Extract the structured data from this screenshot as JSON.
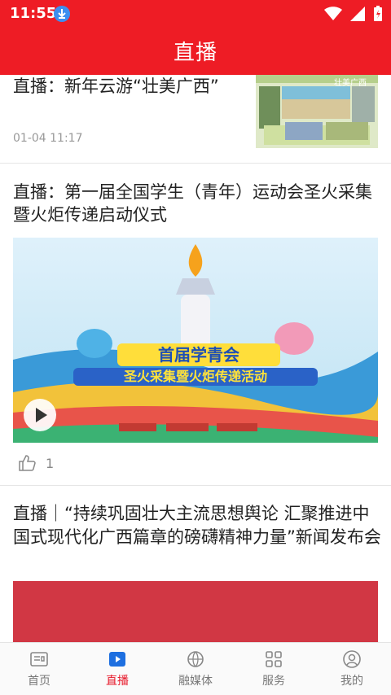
{
  "status": {
    "time": "11:55"
  },
  "header": {
    "title": "直播"
  },
  "feed": [
    {
      "title": "直播：新年云游“壮美广西”",
      "date": "01-04 11:17",
      "thumb_caption": "壮美广西"
    },
    {
      "title": "直播：第一届全国学生（青年）运动会圣火采集暨火炬传递启动仪式",
      "banner_line1": "首届学青会",
      "banner_line2": "圣火采集暨火炬传递活动",
      "likes": "1"
    },
    {
      "title": "直播｜“持续巩固壮大主流思想舆论 汇聚推进中国式现代化广西篇章的磅礴精神力量”新闻发布会"
    }
  ],
  "tabs": [
    {
      "label": "首页",
      "icon": "news-icon"
    },
    {
      "label": "直播",
      "icon": "play-icon"
    },
    {
      "label": "融媒体",
      "icon": "globe-icon"
    },
    {
      "label": "服务",
      "icon": "grid-icon"
    },
    {
      "label": "我的",
      "icon": "user-icon"
    }
  ],
  "colors": {
    "brand_red": "#ee1c25",
    "active_tab": "#e7192a"
  }
}
